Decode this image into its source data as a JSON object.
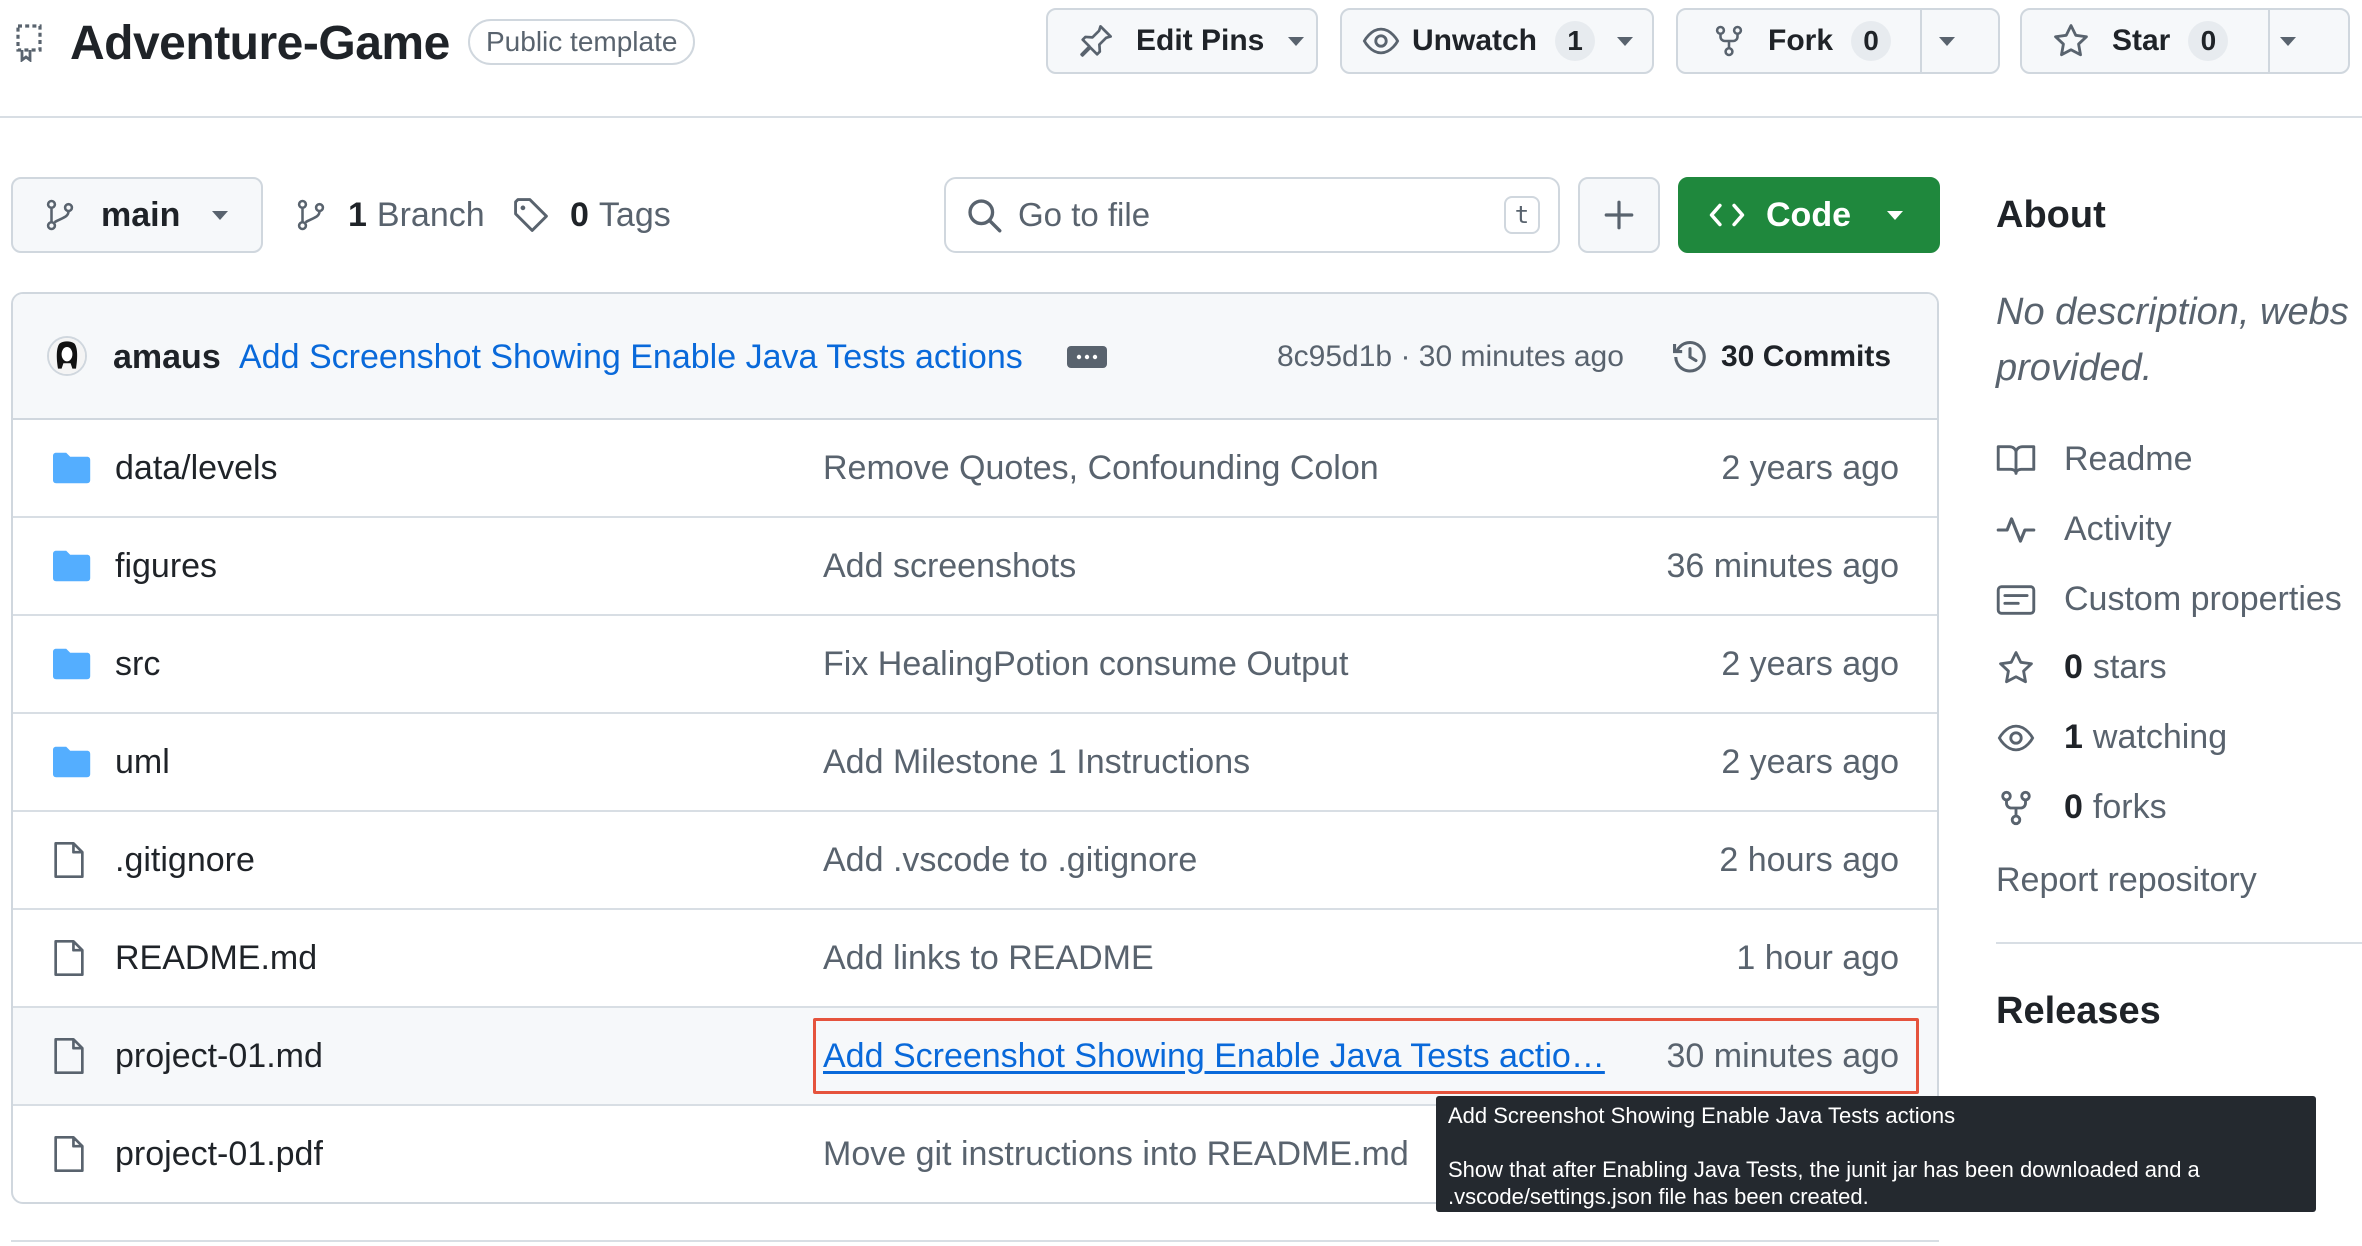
{
  "header": {
    "repo_name": "Adventure-Game",
    "visibility": "Public template",
    "edit_pins": "Edit Pins",
    "unwatch": "Unwatch",
    "watch_count": "1",
    "fork": "Fork",
    "fork_count": "0",
    "star": "Star",
    "star_count": "0"
  },
  "toolbar": {
    "branch": "main",
    "branch_count": "1",
    "branch_label": "Branch",
    "tag_count": "0",
    "tag_label": "Tags",
    "search_placeholder": "Go to file",
    "search_shortcut": "t",
    "code_button": "Code"
  },
  "latest_commit": {
    "author": "amaus",
    "message": "Add Screenshot Showing Enable Java Tests actions",
    "meta": "8c95d1b · 30 minutes ago",
    "commits_label": "30 Commits"
  },
  "files": [
    {
      "type": "folder",
      "name": "data/levels",
      "message": "Remove Quotes, Confounding Colon",
      "age": "2 years ago"
    },
    {
      "type": "folder",
      "name": "figures",
      "message": "Add screenshots",
      "age": "36 minutes ago"
    },
    {
      "type": "folder",
      "name": "src",
      "message": "Fix HealingPotion consume Output",
      "age": "2 years ago"
    },
    {
      "type": "folder",
      "name": "uml",
      "message": "Add Milestone 1 Instructions",
      "age": "2 years ago"
    },
    {
      "type": "file",
      "name": ".gitignore",
      "message": "Add .vscode to .gitignore",
      "age": "2 hours ago"
    },
    {
      "type": "file",
      "name": "README.md",
      "message": "Add links to README",
      "age": "1 hour ago"
    },
    {
      "type": "file",
      "name": "project-01.md",
      "message": "Add Screenshot Showing Enable Java Tests actio…",
      "age": "30 minutes ago"
    },
    {
      "type": "file",
      "name": "project-01.pdf",
      "message": "Move git instructions into README.md",
      "age": ""
    }
  ],
  "about": {
    "title": "About",
    "description_line1": "No description, webs",
    "description_line2": "provided.",
    "readme": "Readme",
    "activity": "Activity",
    "custom_properties": "Custom properties",
    "stars_count": "0",
    "stars_label": "stars",
    "watching_count": "1",
    "watching_label": "watching",
    "forks_count": "0",
    "forks_label": "forks",
    "report": "Report repository"
  },
  "releases": {
    "title": "Releases"
  },
  "tooltip": {
    "title": "Add Screenshot Showing Enable Java Tests actions",
    "body_line1": "Show that after Enabling Java Tests, the junit jar has been downloaded and a",
    "body_line2": ".vscode/settings.json file has been created."
  },
  "colors": {
    "link": "#0969da",
    "primary_green": "#1f883d",
    "folder": "#54aeff",
    "highlight_border": "#e5533d"
  }
}
